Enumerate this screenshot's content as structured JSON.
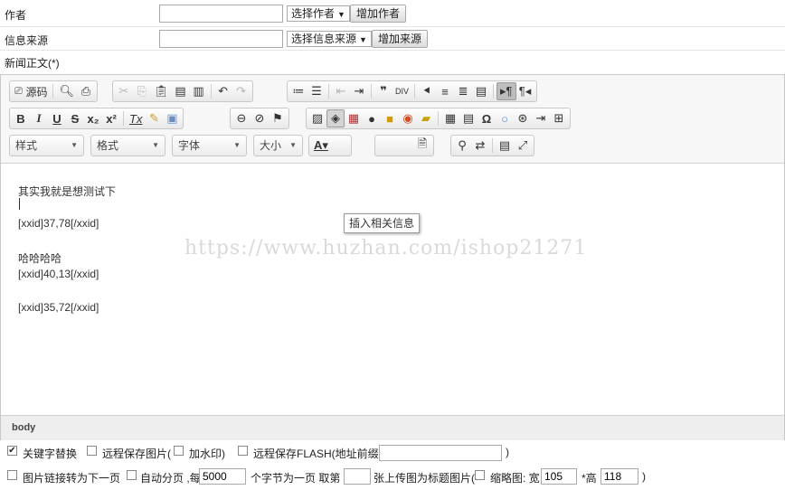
{
  "author": {
    "label": "作者",
    "value": "",
    "select": "选择作者",
    "add_button": "增加作者"
  },
  "source": {
    "label": "信息来源",
    "value": "",
    "select": "选择信息来源",
    "add_button": "增加来源"
  },
  "body_label": "新闻正文(*)",
  "toolbar": {
    "source_btn": "源码",
    "style_combo": "样式",
    "format_combo": "格式",
    "font_combo": "字体",
    "size_combo": "大小",
    "tooltip": "插入相关信息",
    "bold": "B",
    "italic": "I",
    "underline": "U",
    "strike": "S",
    "sub": "x₂",
    "sup": "x²",
    "omega": "Ω"
  },
  "content": {
    "lines": [
      "其实我就是想测试下",
      "[xxid]37,78[/xxid]",
      "哈哈哈哈",
      "[xxid]40,13[/xxid]",
      "[xxid]35,72[/xxid]"
    ]
  },
  "watermark": "https://www.huzhan.com/ishop21271",
  "path": "body",
  "options": {
    "keyword_replace": {
      "label": "关键字替换",
      "checked": true
    },
    "remote_image": {
      "label": "远程保存图片(",
      "checked": false
    },
    "watermark_opt": {
      "label": "加水印)",
      "checked": false
    },
    "remote_flash": {
      "label": "远程保存FLASH(地址前缀:",
      "checked": false
    },
    "flash_prefix": "",
    "close_paren": ")",
    "link_next": {
      "label": "图片链接转为下一页",
      "checked": false
    },
    "auto_page": {
      "label": "自动分页 ,每",
      "checked": false
    },
    "page_bytes": "5000",
    "bytes_text": "个字节为一页  取第",
    "nth_image": "",
    "title_img_text": "张上传图为标题图片(",
    "thumbnail": {
      "label": "缩略图: 宽",
      "checked": false
    },
    "width": "105",
    "height_label": "*高",
    "height": "118",
    "end_paren": ")"
  }
}
